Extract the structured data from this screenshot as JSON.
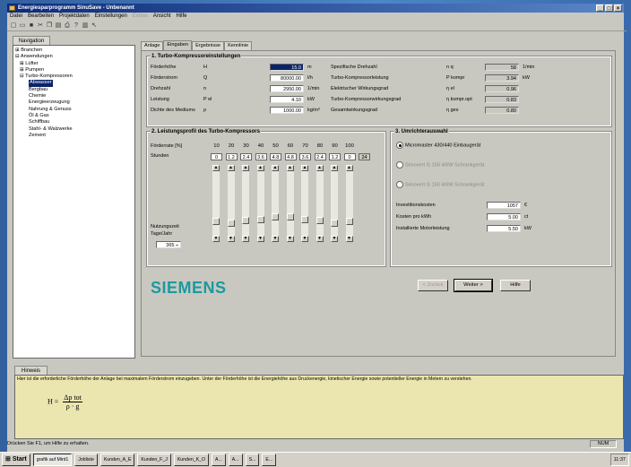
{
  "window": {
    "title": "Energiesparprogramm SinuSave - Unbenannt"
  },
  "menu": [
    "Datei",
    "Bearbeiten",
    "Projektdaten",
    "Einstellungen",
    "Extras",
    "Ansicht",
    "Hilfe"
  ],
  "menu_disabled": "Extras",
  "navigation": {
    "tab": "Navigation",
    "tree": [
      "⊞ Branchen",
      "⊟ Anwendungen",
      "  ⊞ Lüfter",
      "  ⊞ Pumpen",
      "  ⊟ Turbo-Kompressoren",
      "      Abwasser",
      "      Bergbau",
      "      Chemie",
      "      Energieerzeugung",
      "      Nahrung & Genuss",
      "      Öl & Gas",
      "      Schiffbau",
      "      Stahl- & Walzwerke",
      "      Zement"
    ],
    "selected": "Abwasser"
  },
  "tabs": [
    "Anlage",
    "Eingaben",
    "Ergebnisse",
    "Kennlinie"
  ],
  "section1": {
    "title": "1. Turbo-Kompressoreinstellungen",
    "left": [
      {
        "label": "Förderhöhe",
        "sym": "H",
        "value": "15.0",
        "unit": "m"
      },
      {
        "label": "Förderstrom",
        "sym": "Q",
        "value": "80000.00",
        "unit": "l/h"
      },
      {
        "label": "Drehzahl",
        "sym": "n",
        "value": "2950.00",
        "unit": "1/min"
      },
      {
        "label": "Leistung",
        "sym": "P el",
        "value": "4.10",
        "unit": "kW"
      },
      {
        "label": "Dichte des Mediums",
        "sym": "ρ",
        "value": "1000.00",
        "unit": "kg/m³"
      }
    ],
    "right": [
      {
        "label": "Spezifische Drehzahl",
        "sym": "n q",
        "value": "58",
        "unit": "1/min"
      },
      {
        "label": "Turbo-Kompressorleistung",
        "sym": "P kompr",
        "value": "3.94",
        "unit": "kW"
      },
      {
        "label": "Elektrischer Wirkungsgrad",
        "sym": "η el",
        "value": "0.96",
        "unit": ""
      },
      {
        "label": "Turbo-Kompressorwirkungsgrad",
        "sym": "η kompr.opt",
        "value": "0.83",
        "unit": ""
      },
      {
        "label": "Gesamtwirkungsgrad",
        "sym": "η ges",
        "value": "0.80",
        "unit": ""
      }
    ]
  },
  "section2": {
    "title": "2. Leistungsprofil des Turbo-Kompressors",
    "foerderrate_label": "Förderrate [%]",
    "stunden_label": "Stunden",
    "percents": [
      "10",
      "20",
      "30",
      "40",
      "50",
      "60",
      "70",
      "80",
      "90",
      "100"
    ],
    "hours": [
      "0",
      "1.2",
      "2.4",
      "3.6",
      "4.8",
      "4.8",
      "3.6",
      "2.4",
      "1.2",
      "0"
    ],
    "total": "24",
    "slider_levels": [
      0.18,
      0.16,
      0.2,
      0.22,
      0.26,
      0.26,
      0.22,
      0.2,
      0.16,
      0.18
    ],
    "nutzungszeit_label1": "Nutzungszeit",
    "nutzungszeit_label2": "Tage/Jahr",
    "days": "365"
  },
  "section3": {
    "title": "3. Umrichterauswahl",
    "options": [
      {
        "label": "Micromaster 430/440 Einbaugerät",
        "checked": true,
        "disabled": false
      },
      {
        "label": "Simovert G 150 4/6W Schrankgerät",
        "checked": false,
        "disabled": true
      },
      {
        "label": "Simovert G 150 4/6W Schrankgerät",
        "checked": false,
        "disabled": true
      }
    ],
    "fields": [
      {
        "label": "Investitionskosten",
        "value": "1057",
        "unit": "€"
      },
      {
        "label": "Kosten pro kWh",
        "value": "5.00",
        "unit": "ct"
      },
      {
        "label": "Installierte Motorleistung",
        "value": "5.50",
        "unit": "kW"
      }
    ]
  },
  "brand": "SIEMENS",
  "buttons": {
    "back": "< Zurück",
    "next": "Weiter >",
    "help": "Hilfe"
  },
  "hint": {
    "tab": "Hinweis",
    "text": "Hier ist die erforderliche Förderhöhe der Anlage bei maximalem Förderstrom einzugeben. Unter der Förderhöhe ist die Energiehöhe aus Druckenergie, kinetischer Energie sowie potentieller Energie in Metern zu verstehen.",
    "formula_lhs": "H =",
    "formula_num": "Δp tot",
    "formula_den": "ρ · g"
  },
  "status": {
    "text": "Drücken Sie F1, um Hilfe zu erhalten.",
    "num": "NUM"
  },
  "taskbar": {
    "start": "Start",
    "items": [
      "grafik auf Mint1",
      "Jobliste",
      "Kunden_A_E",
      "Kunden_F_J",
      "Kunden_K_O",
      "A...",
      "A...",
      "S...",
      "E..."
    ],
    "clock": "11:37"
  }
}
